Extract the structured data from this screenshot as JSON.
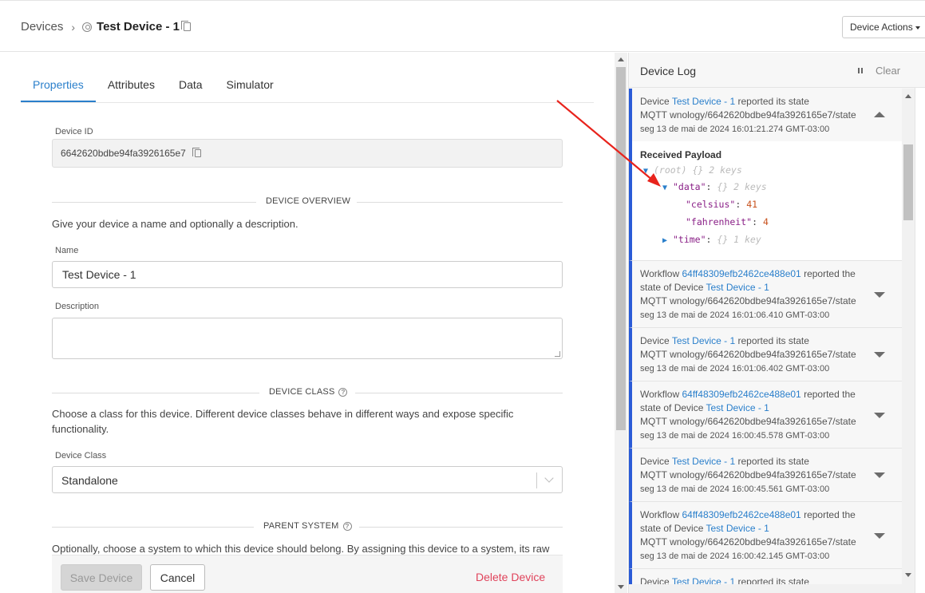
{
  "header": {
    "breadcrumb_root": "Devices",
    "breadcrumb_sep": "›",
    "device_name": "Test Device - 1",
    "device_actions_label": "Device Actions"
  },
  "tabs": [
    {
      "label": "Properties",
      "active": true
    },
    {
      "label": "Attributes",
      "active": false
    },
    {
      "label": "Data",
      "active": false
    },
    {
      "label": "Simulator",
      "active": false
    }
  ],
  "form": {
    "device_id_label": "Device ID",
    "device_id_value": "6642620bdbe94fa3926165e7",
    "overview_title": "DEVICE OVERVIEW",
    "overview_desc": "Give your device a name and optionally a description.",
    "name_label": "Name",
    "name_value": "Test Device - 1",
    "description_label": "Description",
    "description_value": "",
    "class_title": "DEVICE CLASS",
    "class_desc": "Choose a class for this device. Different device classes behave in different ways and expose specific functionality.",
    "class_label": "Device Class",
    "class_value": "Standalone",
    "parent_title": "PARENT SYSTEM",
    "parent_desc": "Optionally, choose a system to which this device should belong. By assigning this device to a system, its raw"
  },
  "actions": {
    "save_label": "Save Device",
    "cancel_label": "Cancel",
    "delete_label": "Delete Device"
  },
  "log": {
    "title": "Device Log",
    "clear_label": "Clear",
    "payload_title": "Received Payload",
    "payload": {
      "root": "(root)",
      "root_meta": "{} 2 keys",
      "data_key": "\"data\"",
      "data_meta": "{} 2 keys",
      "celsius_key": "\"celsius\"",
      "celsius_value": "41",
      "fahrenheit_key": "\"fahrenheit\"",
      "fahrenheit_value": "4",
      "time_key": "\"time\"",
      "time_meta": "{} 1 key"
    },
    "entries": [
      {
        "kind": "device",
        "prefix": "Device",
        "link": "Test Device - 1",
        "suffix": "reported its state",
        "topic": "MQTT wnology/6642620bdbe94fa3926165e7/state",
        "time": "seg 13 de mai de 2024 16:01:21.274 GMT-03:00"
      },
      {
        "kind": "workflow",
        "prefix": "Workflow",
        "link": "64ff48309efb2462ce488e01",
        "suffix": "reported the",
        "line2_prefix": "state of Device",
        "link2": "Test Device - 1",
        "topic": "MQTT wnology/6642620bdbe94fa3926165e7/state",
        "time": "seg 13 de mai de 2024 16:01:06.410 GMT-03:00"
      },
      {
        "kind": "device",
        "prefix": "Device",
        "link": "Test Device - 1",
        "suffix": "reported its state",
        "topic": "MQTT wnology/6642620bdbe94fa3926165e7/state",
        "time": "seg 13 de mai de 2024 16:01:06.402 GMT-03:00"
      },
      {
        "kind": "workflow",
        "prefix": "Workflow",
        "link": "64ff48309efb2462ce488e01",
        "suffix": "reported the",
        "line2_prefix": "state of Device",
        "link2": "Test Device - 1",
        "topic": "MQTT wnology/6642620bdbe94fa3926165e7/state",
        "time": "seg 13 de mai de 2024 16:00:45.578 GMT-03:00"
      },
      {
        "kind": "device",
        "prefix": "Device",
        "link": "Test Device - 1",
        "suffix": "reported its state",
        "topic": "MQTT wnology/6642620bdbe94fa3926165e7/state",
        "time": "seg 13 de mai de 2024 16:00:45.561 GMT-03:00"
      },
      {
        "kind": "workflow",
        "prefix": "Workflow",
        "link": "64ff48309efb2462ce488e01",
        "suffix": "reported the",
        "line2_prefix": "state of Device",
        "link2": "Test Device - 1",
        "topic": "MQTT wnology/6642620bdbe94fa3926165e7/state",
        "time": "seg 13 de mai de 2024 16:00:42.145 GMT-03:00"
      },
      {
        "kind": "device",
        "prefix": "Device",
        "link": "Test Device - 1",
        "suffix": "reported its state"
      }
    ]
  },
  "colors": {
    "accent": "#2a7fcb",
    "log_bar": "#2a5bd7",
    "danger": "#e0435b",
    "annotation": "#e8231c"
  },
  "icons": {
    "device": "gear-icon",
    "copy": "copy-icon",
    "help": "help-icon",
    "pause": "pause-icon",
    "expand": "chevron-down-icon",
    "collapse": "chevron-up-icon"
  }
}
